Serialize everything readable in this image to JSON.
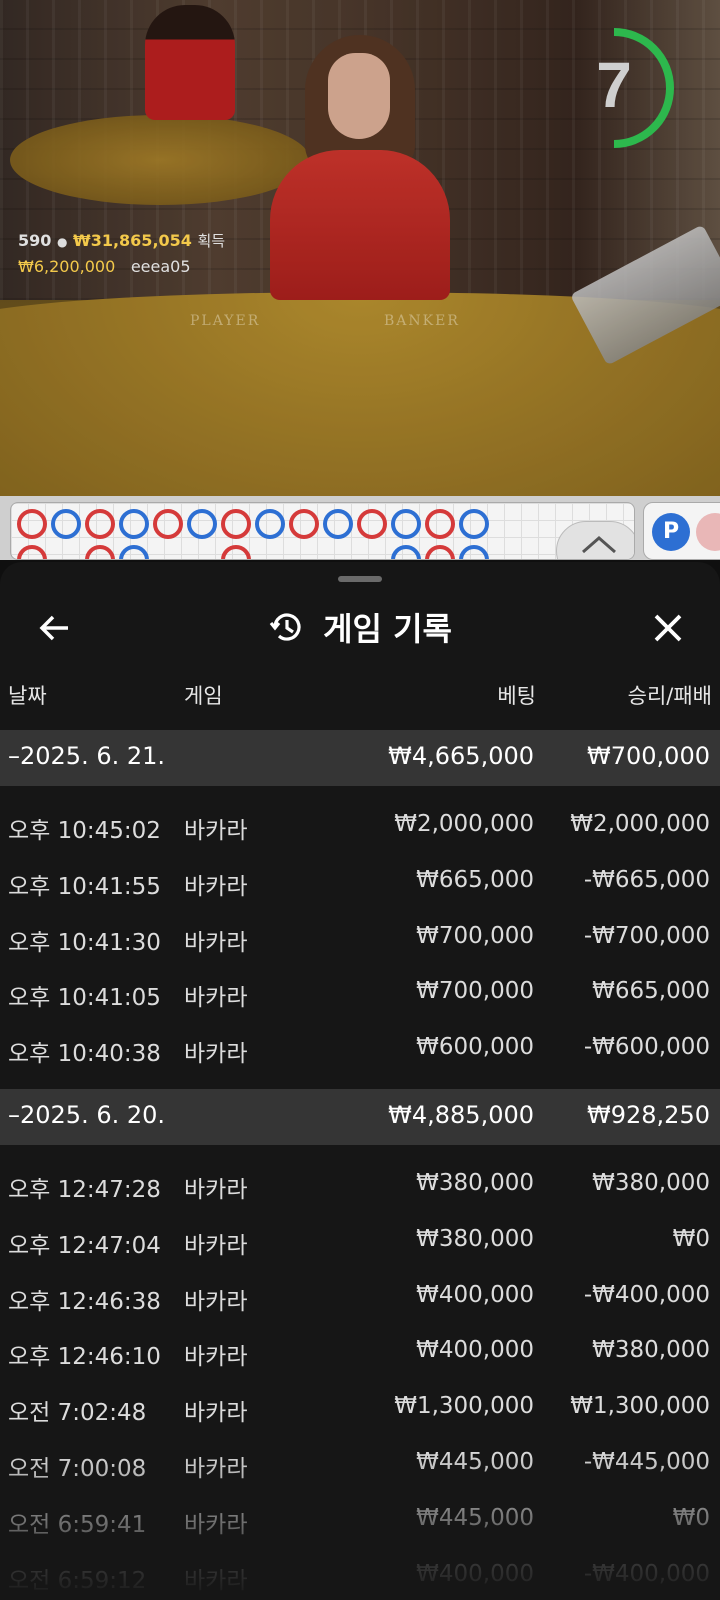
{
  "video": {
    "felt_labels": [
      "PLAYER",
      "BANKER"
    ],
    "win_info": {
      "count": "590",
      "amount": "₩31,865,054",
      "label": "획득",
      "last_amount": "₩6,200,000",
      "last_user": "eeea05"
    },
    "timer": {
      "value": "7",
      "fraction": 0.5,
      "color": "#2db84d"
    }
  },
  "road": {
    "prediction_label": "P",
    "colors": {
      "player": "#2d6fd3",
      "banker": "#d53a3a"
    }
  },
  "sheet": {
    "title": "게임 기록",
    "columns": {
      "date": "날짜",
      "game": "게임",
      "bet": "베팅",
      "win_loss": "승리/패배"
    },
    "groups": [
      {
        "date": "–2025. 6. 21.",
        "bet_total": "₩4,665,000",
        "win_total": "₩700,000",
        "rows": [
          {
            "time": "오후 10:45:02",
            "game": "바카라",
            "bet": "₩2,000,000",
            "result": "₩2,000,000"
          },
          {
            "time": "오후 10:41:55",
            "game": "바카라",
            "bet": "₩665,000",
            "result": "-₩665,000"
          },
          {
            "time": "오후 10:41:30",
            "game": "바카라",
            "bet": "₩700,000",
            "result": "-₩700,000"
          },
          {
            "time": "오후 10:41:05",
            "game": "바카라",
            "bet": "₩700,000",
            "result": "₩665,000"
          },
          {
            "time": "오후 10:40:38",
            "game": "바카라",
            "bet": "₩600,000",
            "result": "-₩600,000"
          }
        ]
      },
      {
        "date": "–2025. 6. 20.",
        "bet_total": "₩4,885,000",
        "win_total": "₩928,250",
        "rows": [
          {
            "time": "오후 12:47:28",
            "game": "바카라",
            "bet": "₩380,000",
            "result": "₩380,000"
          },
          {
            "time": "오후 12:47:04",
            "game": "바카라",
            "bet": "₩380,000",
            "result": "₩0"
          },
          {
            "time": "오후 12:46:38",
            "game": "바카라",
            "bet": "₩400,000",
            "result": "-₩400,000"
          },
          {
            "time": "오후 12:46:10",
            "game": "바카라",
            "bet": "₩400,000",
            "result": "₩380,000"
          },
          {
            "time": "오전 7:02:48",
            "game": "바카라",
            "bet": "₩1,300,000",
            "result": "₩1,300,000"
          },
          {
            "time": "오전 7:00:08",
            "game": "바카라",
            "bet": "₩445,000",
            "result": "-₩445,000"
          },
          {
            "time": "오전 6:59:41",
            "game": "바카라",
            "bet": "₩445,000",
            "result": "₩0"
          },
          {
            "time": "오전 6:59:12",
            "game": "바카라",
            "bet": "₩400,000",
            "result": "-₩400,000"
          }
        ]
      }
    ]
  }
}
